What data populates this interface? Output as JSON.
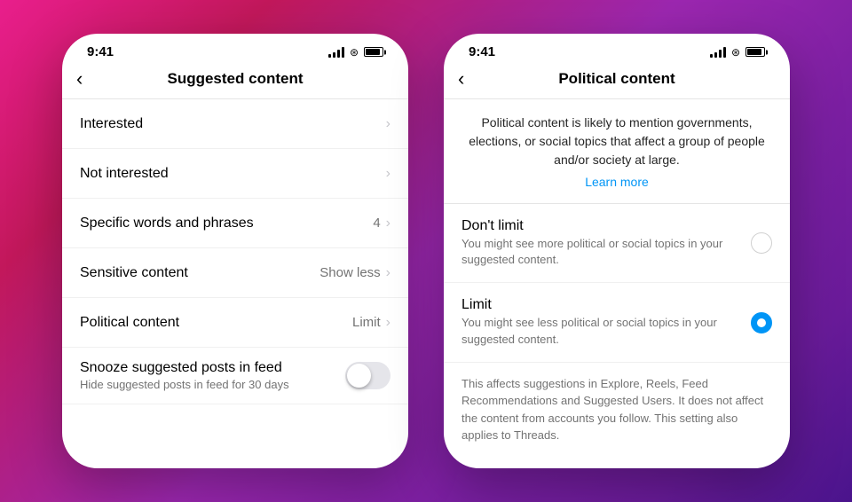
{
  "screen1": {
    "status_time": "9:41",
    "header": {
      "title": "Suggested content",
      "back_label": "‹"
    },
    "menu_items": [
      {
        "id": "interested",
        "label": "Interested",
        "value": "",
        "has_chevron": true
      },
      {
        "id": "not_interested",
        "label": "Not interested",
        "value": "",
        "has_chevron": true
      },
      {
        "id": "words_phrases",
        "label": "Specific words and phrases",
        "value": "4",
        "has_chevron": true
      },
      {
        "id": "sensitive_content",
        "label": "Sensitive content",
        "value": "Show less",
        "has_chevron": true
      },
      {
        "id": "political_content",
        "label": "Political content",
        "value": "Limit",
        "has_chevron": true
      }
    ],
    "snooze": {
      "label": "Snooze suggested posts in feed",
      "subtitle": "Hide suggested posts in feed for 30 days"
    }
  },
  "screen2": {
    "status_time": "9:41",
    "header": {
      "title": "Political content",
      "back_label": "‹"
    },
    "description": "Political content is likely to mention governments, elections, or social topics that affect a group of people and/or society at large.",
    "learn_more": "Learn more",
    "options": [
      {
        "id": "dont_limit",
        "label": "Don't limit",
        "sublabel": "You might see more political or social topics in your suggested content.",
        "selected": false
      },
      {
        "id": "limit",
        "label": "Limit",
        "sublabel": "You might see less political or social topics in your suggested content.",
        "selected": true
      }
    ],
    "notice": "This affects suggestions in Explore, Reels, Feed Recommendations and Suggested Users. It does not affect the content from accounts you follow. This setting also applies to Threads."
  },
  "colors": {
    "accent_blue": "#0095f6",
    "chevron": "#c7c7cc",
    "text_secondary": "#737373"
  }
}
